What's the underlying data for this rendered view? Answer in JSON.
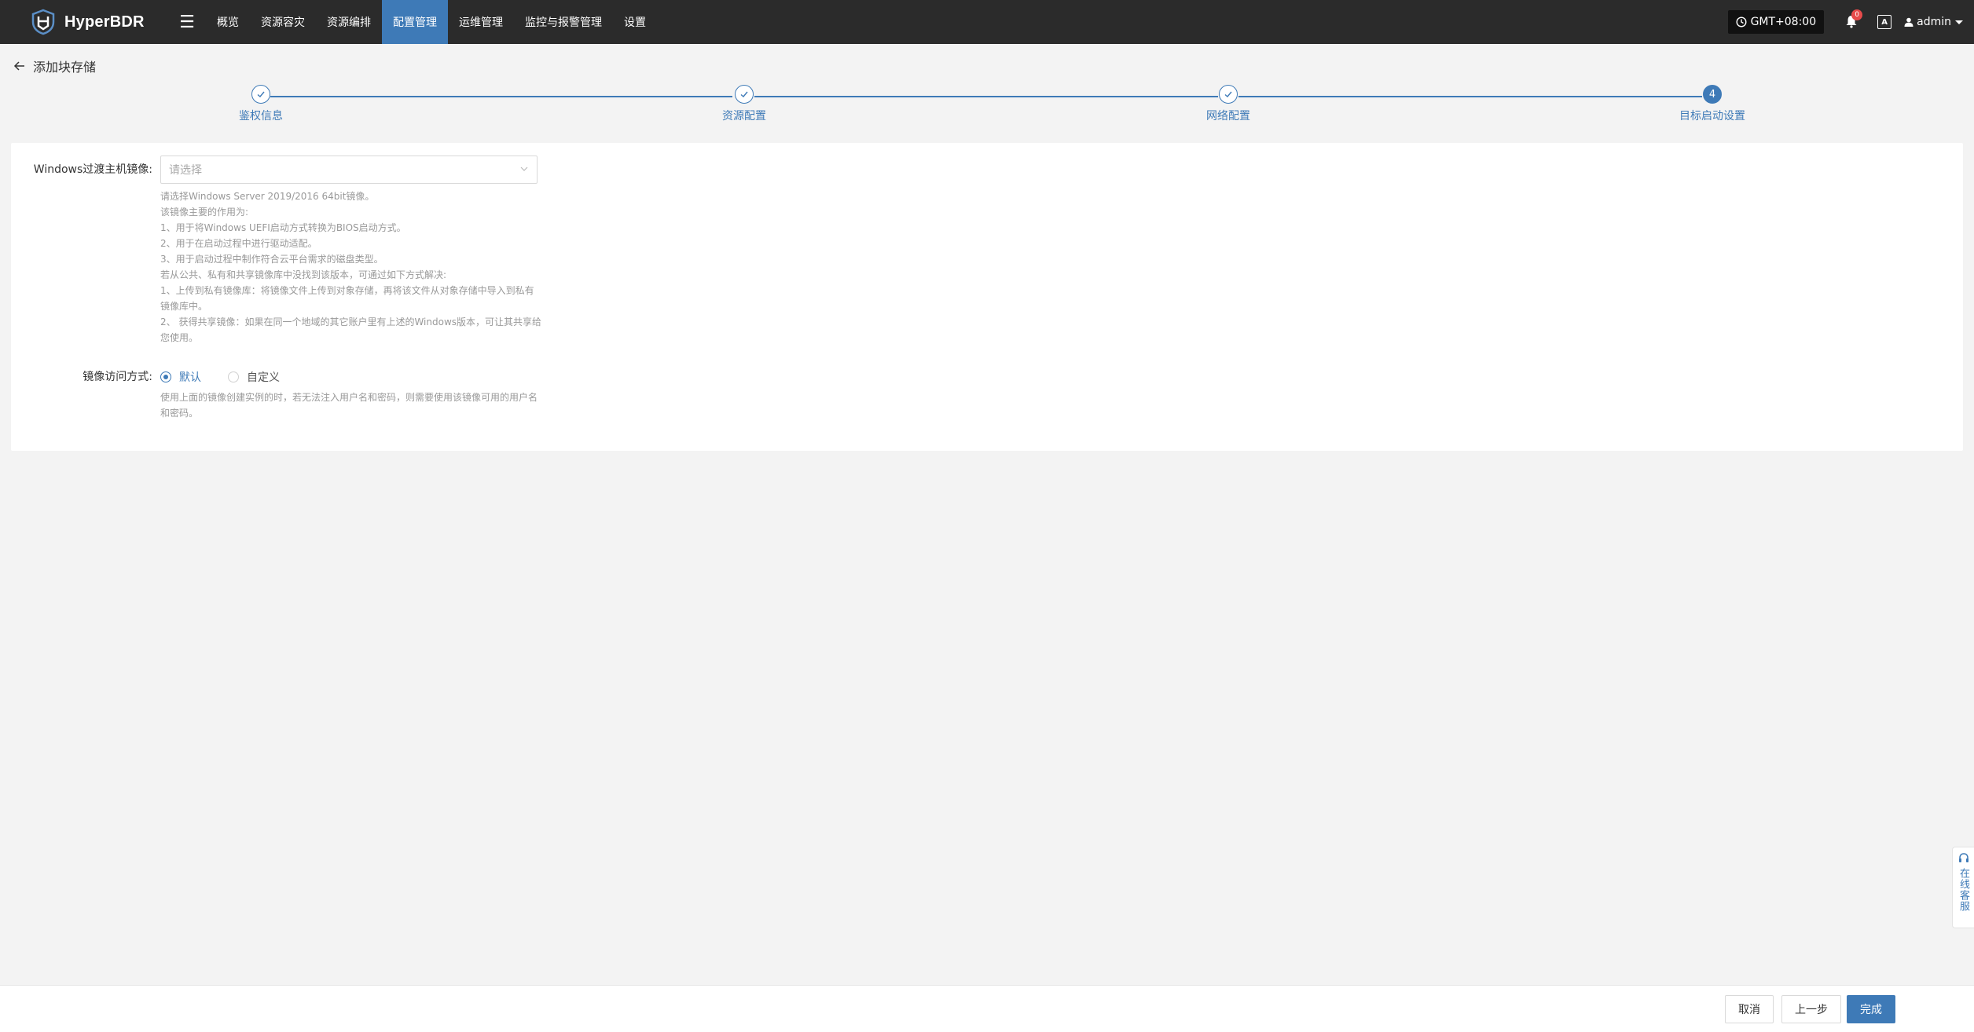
{
  "app": {
    "brand": "HyperBDR"
  },
  "nav": [
    {
      "label": "概览",
      "active": false
    },
    {
      "label": "资源容灾",
      "active": false
    },
    {
      "label": "资源编排",
      "active": false
    },
    {
      "label": "配置管理",
      "active": true
    },
    {
      "label": "运维管理",
      "active": false
    },
    {
      "label": "监控与报警管理",
      "active": false
    },
    {
      "label": "设置",
      "active": false
    }
  ],
  "topright": {
    "timezone": "GMT+08:00",
    "notification_count": "0",
    "lang_icon": "A",
    "user": "admin"
  },
  "page": {
    "title": "添加块存储"
  },
  "steps": [
    {
      "label": "鉴权信息",
      "state": "done"
    },
    {
      "label": "资源配置",
      "state": "done"
    },
    {
      "label": "网络配置",
      "state": "done"
    },
    {
      "label": "目标启动设置",
      "state": "current",
      "number": "4"
    }
  ],
  "form": {
    "image": {
      "label": "Windows过渡主机镜像:",
      "placeholder": "请选择",
      "help": [
        "请选择Windows Server 2019/2016 64bit镜像。",
        "该镜像主要的作用为:",
        "1、用于将Windows UEFI启动方式转换为BIOS启动方式。",
        "2、用于在启动过程中进行驱动适配。",
        "3、用于启动过程中制作符合云平台需求的磁盘类型。",
        "若从公共、私有和共享镜像库中没找到该版本，可通过如下方式解决:",
        "1、上传到私有镜像库：将镜像文件上传到对象存储，再将该文件从对象存储中导入到私有",
        "镜像库中。",
        "2、 获得共享镜像：如果在同一个地域的其它账户里有上述的Windows版本，可让其共享给",
        "您使用。"
      ]
    },
    "access": {
      "label": "镜像访问方式:",
      "options": [
        {
          "label": "默认",
          "checked": true
        },
        {
          "label": "自定义",
          "checked": false
        }
      ],
      "help": [
        "使用上面的镜像创建实例的时，若无法注入用户名和密码，则需要使用该镜像可用的用户名",
        "和密码。"
      ]
    }
  },
  "footer": {
    "cancel": "取消",
    "prev": "上一步",
    "finish": "完成"
  },
  "service": {
    "label": "在线客服"
  },
  "colors": {
    "accent": "#3e7ab7",
    "topbar": "#2b2b2b",
    "background": "#f3f3f3"
  }
}
